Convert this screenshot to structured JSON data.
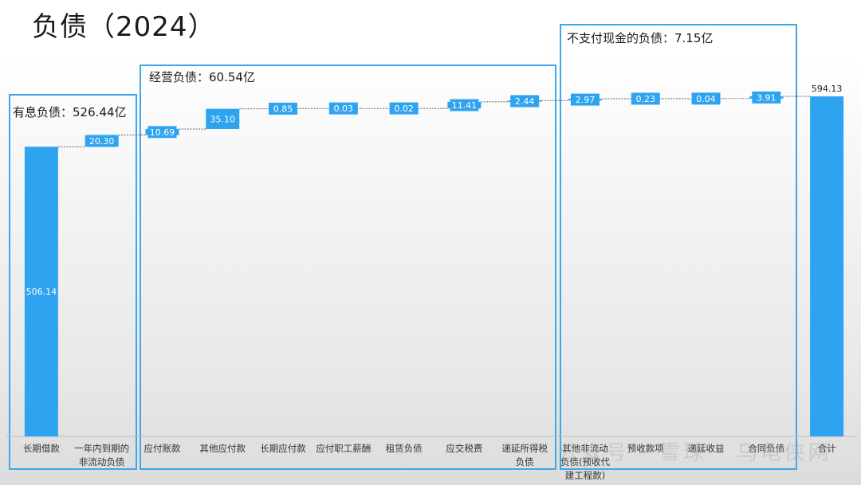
{
  "slide": {
    "title": "负债（2024）"
  },
  "groups": [
    {
      "label": "有息负债：526.44亿"
    },
    {
      "label": "经营负债：60.54亿"
    },
    {
      "label": "不支付现金的负债：7.15亿"
    }
  ],
  "watermark": "公众号  ·  雪球  ·  乌龟侠网",
  "colors": {
    "bar": "#2ea3ef",
    "box": "#3fa7e8",
    "label_text": "#ffffff",
    "connector": "#333333"
  },
  "chart_data": {
    "type": "waterfall",
    "categories": [
      "长期借款",
      "一年内到期的非流动负债",
      "应付账款",
      "其他应付款",
      "长期应付款",
      "应付职工薪酬",
      "租赁负债",
      "应交税费",
      "递延所得税负债",
      "其他非流动负债(预收代建工程款)",
      "预收款项",
      "递延收益",
      "合同负债",
      "合计"
    ],
    "category_lines": [
      [
        "长期借款"
      ],
      [
        "一年内到期的",
        "非流动负债"
      ],
      [
        "应付账款"
      ],
      [
        "其他应付款"
      ],
      [
        "长期应付款"
      ],
      [
        "应付职工薪酬"
      ],
      [
        "租赁负债"
      ],
      [
        "应交税费"
      ],
      [
        "递延所得税",
        "负债"
      ],
      [
        "其他非流动",
        "负债(预收代",
        "建工程款)"
      ],
      [
        "预收款项"
      ],
      [
        "递延收益"
      ],
      [
        "合同负债"
      ],
      [
        "合计"
      ]
    ],
    "values": [
      506.14,
      20.3,
      10.69,
      35.1,
      0.85,
      0.03,
      0.02,
      11.41,
      2.44,
      2.97,
      0.23,
      0.04,
      3.91,
      594.13
    ],
    "value_labels": [
      "506.14",
      "20.30",
      "10.69",
      "35.10",
      "0.85",
      "0.03",
      "0.02",
      "11.41",
      "2.44",
      "2.97",
      "0.23",
      "0.04",
      "3.91",
      "594.13"
    ],
    "total_index": 13,
    "ylim": [
      0,
      600
    ]
  }
}
